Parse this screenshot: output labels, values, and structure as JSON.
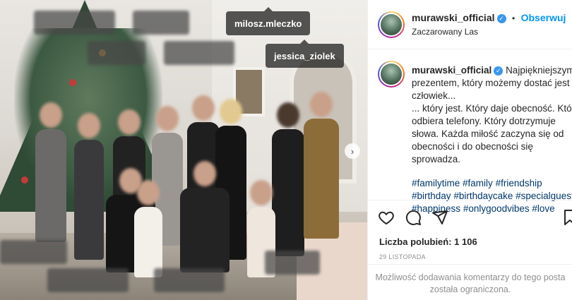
{
  "photo": {
    "visible_tags": [
      {
        "id": "tag-1",
        "label": "milosz.mleczko"
      },
      {
        "id": "tag-2",
        "label": "jessica_ziolek"
      }
    ],
    "next_icon": "chevron-right-icon"
  },
  "header": {
    "username": "murawski_official",
    "verified_icon": "verified-badge-icon",
    "separator": "•",
    "follow_label": "Obserwuj",
    "location": "Zaczarowany Las"
  },
  "caption": {
    "username": "murawski_official",
    "line1": "Najpiękniejszym prezentem, który możemy dostać jest człowiek...",
    "line2": "... który jest. Który daje obecność. Który odbiera telefony. Który dotrzymuje słowa. Każda miłość zaczyna się od obecności i do obecności się sprowadza.",
    "hashtags": [
      "#familytime",
      "#family",
      "#friendship",
      "#birthday",
      "#birthdaycake",
      "#specialguests",
      "#happiness",
      "#onlygoodvibes",
      "#love"
    ]
  },
  "actions": {
    "like_icon": "heart-icon",
    "comment_icon": "comment-icon",
    "share_icon": "share-icon",
    "save_icon": "bookmark-icon"
  },
  "likes_text": "Liczba polubień: 1 106",
  "date_text": "29 LISTOPADA",
  "restricted_text": "Możliwość dodawania komentarzy do tego posta została ograniczona.",
  "colors": {
    "accent": "#0095f6",
    "hashtag": "#00376b",
    "muted": "#8e8e8e",
    "tag_bg": "#262626"
  }
}
